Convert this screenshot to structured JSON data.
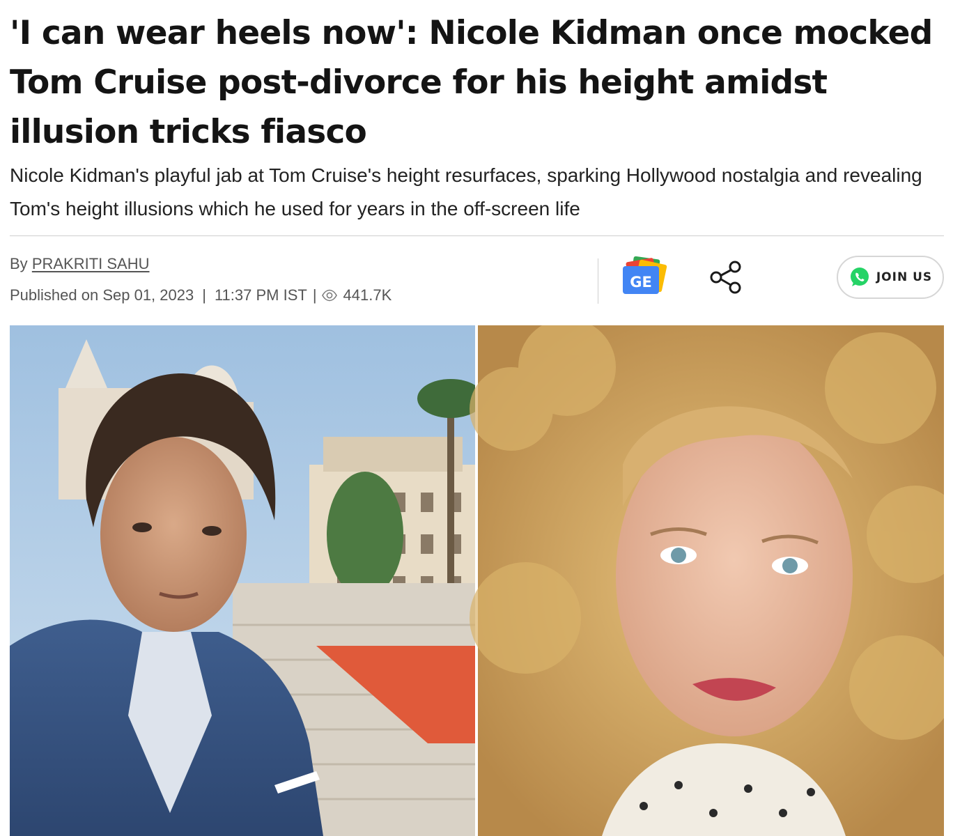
{
  "article": {
    "headline": "'I can wear heels now': Nicole Kidman once mocked Tom Cruise post-divorce for his height amidst illusion tricks fiasco",
    "subheadline": "Nicole Kidman's playful jab at Tom Cruise's height resurfaces, sparking Hollywood nostalgia and revealing Tom's height illusions which he used for years in the off-screen life",
    "byline_prefix": "By",
    "author": "PRAKRITI SAHU",
    "published_label": "Published on Sep 01, 2023",
    "time": "11:37 PM IST",
    "separator": "|",
    "views": "441.7K"
  },
  "actions": {
    "google_news_badge": "GE",
    "join_label": "JOIN US"
  },
  "icons": {
    "google_news": "google-news-icon",
    "share": "share-icon",
    "whatsapp": "whatsapp-icon",
    "views": "eye-icon"
  },
  "colors": {
    "whatsapp_green": "#25D366",
    "gnews_blue": "#4285F4",
    "gnews_red": "#EA4335",
    "gnews_yellow": "#FBBC04",
    "gnews_green": "#34A853"
  }
}
